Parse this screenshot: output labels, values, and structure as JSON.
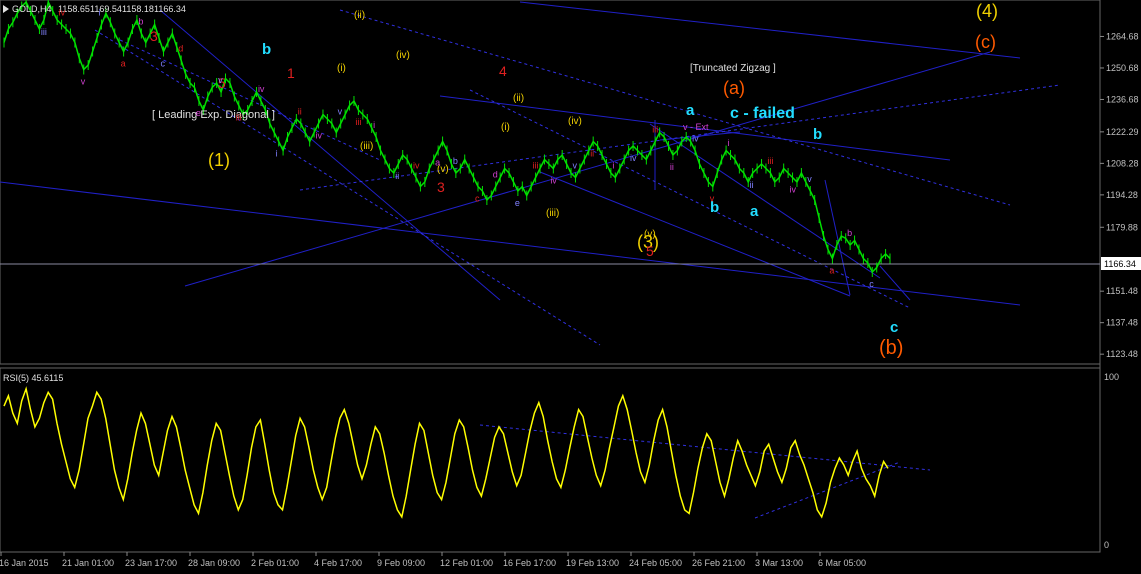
{
  "chart_data": {
    "type": "line",
    "title": "GOLD,H4",
    "ohlc": {
      "open": "1158.65",
      "high": "1169.54",
      "low": "1158.18",
      "close": "1166.34"
    },
    "current_price_label": "1166.34",
    "price_axis": {
      "range": [
        1120,
        1280
      ],
      "ticks": [
        "1264.68",
        "1250.68",
        "1236.68",
        "1222.29",
        "1208.28",
        "1194.28",
        "1179.88",
        "1151.48",
        "1137.48",
        "1123.48"
      ]
    },
    "time_axis": {
      "ticks": [
        "16 Jan 2015",
        "21 Jan 01:00",
        "23 Jan 17:00",
        "28 Jan 09:00",
        "2 Feb 01:00",
        "4 Feb 17:00",
        "9 Feb 09:00",
        "12 Feb 01:00",
        "16 Feb 17:00",
        "19 Feb 13:00",
        "24 Feb 05:00",
        "26 Feb 21:00",
        "3 Mar 13:00",
        "6 Mar 05:00"
      ]
    },
    "series": [
      {
        "values": [
          1262,
          1268,
          1271,
          1275,
          1278,
          1280,
          1276,
          1272,
          1268,
          1272,
          1280,
          1276,
          1272,
          1270,
          1268,
          1266,
          1262,
          1255,
          1250,
          1252,
          1258,
          1264,
          1270,
          1275,
          1271,
          1266,
          1262,
          1258,
          1262,
          1268,
          1272,
          1266,
          1262,
          1266,
          1270,
          1264,
          1258,
          1262,
          1266,
          1260,
          1254,
          1248,
          1244,
          1242,
          1236,
          1232,
          1238,
          1242,
          1244,
          1240,
          1246,
          1244,
          1238,
          1234,
          1230,
          1232,
          1236,
          1240,
          1236,
          1232,
          1226,
          1222,
          1218,
          1214,
          1220,
          1224,
          1228,
          1226,
          1222,
          1218,
          1222,
          1226,
          1230,
          1228,
          1226,
          1222,
          1226,
          1230,
          1234,
          1236,
          1232,
          1230,
          1228,
          1224,
          1220,
          1214,
          1210,
          1206,
          1204,
          1208,
          1212,
          1210,
          1206,
          1202,
          1198,
          1200,
          1206,
          1210,
          1214,
          1218,
          1214,
          1208,
          1204,
          1206,
          1210,
          1206,
          1202,
          1198,
          1196,
          1192,
          1194,
          1198,
          1202,
          1206,
          1204,
          1200,
          1196,
          1198,
          1194,
          1198,
          1202,
          1206,
          1210,
          1208,
          1206,
          1210,
          1212,
          1208,
          1204,
          1202,
          1206,
          1210,
          1214,
          1218,
          1216,
          1212,
          1208,
          1204,
          1202,
          1206,
          1210,
          1214,
          1216,
          1214,
          1212,
          1210,
          1214,
          1218,
          1222,
          1220,
          1216,
          1212,
          1214,
          1218,
          1220,
          1218,
          1214,
          1208,
          1204,
          1200,
          1198,
          1204,
          1210,
          1214,
          1212,
          1210,
          1206,
          1204,
          1200,
          1204,
          1206,
          1208,
          1206,
          1204,
          1200,
          1202,
          1206,
          1204,
          1202,
          1200,
          1204,
          1200,
          1196,
          1192,
          1184,
          1176,
          1170,
          1166,
          1172,
          1176,
          1175,
          1172,
          1174,
          1170,
          1166,
          1164,
          1160,
          1162,
          1166,
          1168,
          1166
        ]
      }
    ],
    "indicator": {
      "label": "RSI(5) 45.6115",
      "range": [
        0,
        100
      ],
      "ticks": [
        "100",
        "0"
      ],
      "values": [
        82,
        88,
        78,
        72,
        85,
        92,
        80,
        70,
        75,
        84,
        90,
        86,
        72,
        60,
        50,
        40,
        35,
        45,
        60,
        75,
        82,
        90,
        86,
        75,
        60,
        45,
        35,
        28,
        40,
        55,
        68,
        78,
        72,
        60,
        48,
        42,
        55,
        68,
        76,
        70,
        58,
        45,
        35,
        25,
        20,
        32,
        48,
        62,
        72,
        68,
        55,
        42,
        30,
        22,
        28,
        42,
        58,
        70,
        74,
        60,
        45,
        32,
        25,
        22,
        35,
        50,
        65,
        75,
        70,
        58,
        45,
        35,
        28,
        35,
        50,
        64,
        75,
        80,
        72,
        60,
        48,
        40,
        48,
        60,
        70,
        66,
        55,
        42,
        30,
        22,
        18,
        30,
        45,
        60,
        72,
        68,
        55,
        42,
        32,
        28,
        38,
        52,
        66,
        74,
        70,
        58,
        45,
        35,
        30,
        40,
        52,
        64,
        70,
        66,
        55,
        44,
        36,
        42,
        55,
        68,
        78,
        84,
        76,
        62,
        50,
        40,
        35,
        45,
        58,
        70,
        80,
        76,
        64,
        52,
        42,
        36,
        45,
        58,
        70,
        82,
        88,
        80,
        68,
        55,
        44,
        38,
        48,
        62,
        74,
        80,
        70,
        56,
        42,
        30,
        22,
        20,
        32,
        46,
        58,
        66,
        62,
        50,
        38,
        30,
        40,
        52,
        62,
        56,
        48,
        42,
        36,
        44,
        56,
        60,
        52,
        44,
        38,
        46,
        58,
        62,
        54,
        48,
        40,
        32,
        22,
        18,
        26,
        38,
        46,
        52,
        48,
        42,
        50,
        56,
        46,
        40,
        36,
        30,
        42,
        50,
        46
      ]
    },
    "wave_labels_yellow": [
      "(1)",
      "(3)",
      "(4)",
      "(i)",
      "(ii)",
      "(iii)",
      "(iv)",
      "(v)",
      "(ii)",
      "(iii)",
      "(iv)",
      "(v)",
      "(i)"
    ],
    "wave_labels_orange": [
      "(a)",
      "(b)",
      "(c)"
    ],
    "wave_labels_red": [
      "3",
      "5",
      "1",
      "4",
      "3",
      "5"
    ],
    "wave_labels_cyan": [
      "a",
      "b",
      "c - failed",
      "b",
      "a",
      "b",
      "c",
      "b"
    ],
    "annotations": {
      "diagonal": "[ Leading Exp. Diagonal ]",
      "zigzag": "[Truncated Zigzag ]",
      "ext": "v - Ext"
    },
    "small_labels": [
      "ii",
      "iii",
      "iv",
      "v",
      "i",
      "a",
      "b",
      "c",
      "d",
      "e",
      "v",
      "iii",
      "iv",
      "i",
      "ii",
      "iv",
      "v",
      "iii",
      "i",
      "ii",
      "iv",
      "a",
      "b",
      "c",
      "d",
      "e",
      "iii",
      "iv",
      "v",
      "ii",
      "i",
      "iv",
      "iii",
      "ii",
      "iv",
      "v",
      "i",
      "ii",
      "iii",
      "iv",
      "v",
      "a",
      "b",
      "c"
    ]
  },
  "colors": {
    "price": "#00e000",
    "rsi": "#ffff00",
    "trend": "#2020c8",
    "trend_dash": "#3030e0",
    "yellow": "#f0d000",
    "orange": "#ff5a00",
    "red": "#e02020",
    "cyan": "#22ddff",
    "purple": "#d040d0"
  }
}
